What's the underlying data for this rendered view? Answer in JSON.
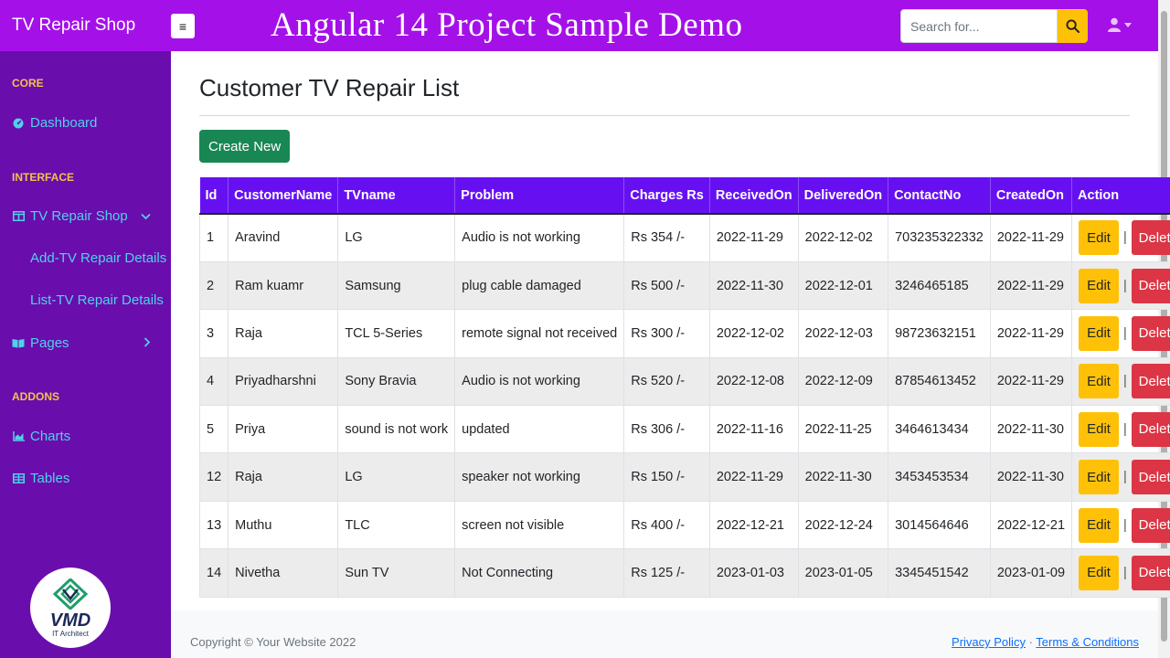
{
  "navbar": {
    "brand": "TV Repair Shop",
    "toggle_label": "≡",
    "banner": "Angular 14 Project Sample Demo",
    "search_placeholder": "Search for..."
  },
  "sidebar": {
    "headings": [
      "CORE",
      "INTERFACE",
      "ADDONS"
    ],
    "dashboard": "Dashboard",
    "tv_repair_shop": "TV Repair Shop",
    "sub_items": [
      "Add-TV Repair Details",
      "List-TV Repair Details"
    ],
    "pages": "Pages",
    "charts": "Charts",
    "tables": "Tables",
    "logo_text": "VMD",
    "logo_sub": "IT Architect"
  },
  "main": {
    "title": "Customer TV Repair List",
    "create_label": "Create New",
    "columns": [
      "Id",
      "CustomerName",
      "TVname",
      "Problem",
      "Charges Rs",
      "ReceivedOn",
      "DeliveredOn",
      "ContactNo",
      "CreatedOn",
      "Action"
    ],
    "edit_label": "Edit",
    "delete_label": "Delete",
    "separator": "|",
    "rows": [
      [
        "1",
        "Aravind",
        "LG",
        "Audio is not working",
        "Rs 354 /-",
        "2022-11-29",
        "2022-12-02",
        "703235322332",
        "2022-11-29"
      ],
      [
        "2",
        "Ram kuamr",
        "Samsung",
        "plug cable damaged",
        "Rs 500 /-",
        "2022-11-30",
        "2022-12-01",
        "3246465185",
        "2022-11-29"
      ],
      [
        "3",
        "Raja",
        "TCL 5-Series",
        "remote signal not received",
        "Rs 300 /-",
        "2022-12-02",
        "2022-12-03",
        "98723632151",
        "2022-11-29"
      ],
      [
        "4",
        "Priyadharshni",
        "Sony Bravia",
        "Audio is not working",
        "Rs 520 /-",
        "2022-12-08",
        "2022-12-09",
        "87854613452",
        "2022-11-29"
      ],
      [
        "5",
        "Priya",
        "sound is not work",
        "updated",
        "Rs 306 /-",
        "2022-11-16",
        "2022-11-25",
        "3464613434",
        "2022-11-30"
      ],
      [
        "12",
        "Raja",
        "LG",
        "speaker not working",
        "Rs 150 /-",
        "2022-11-29",
        "2022-11-30",
        "3453453534",
        "2022-11-30"
      ],
      [
        "13",
        "Muthu",
        "TLC",
        "screen not visible",
        "Rs 400 /-",
        "2022-12-21",
        "2022-12-24",
        "3014564646",
        "2022-12-21"
      ],
      [
        "14",
        "Nivetha",
        "Sun TV",
        "Not Connecting",
        "Rs 125 /-",
        "2023-01-03",
        "2023-01-05",
        "3345451542",
        "2023-01-09"
      ]
    ]
  },
  "footer": {
    "copyright": "Copyright © Your Website 2022",
    "privacy": "Privacy Policy",
    "dot": " · ",
    "terms": "Terms & Conditions"
  }
}
